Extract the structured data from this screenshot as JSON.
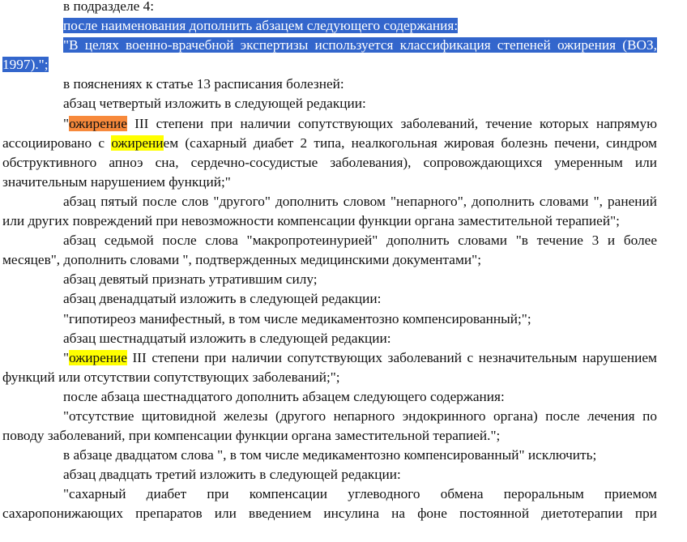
{
  "paragraphs": {
    "p1": "в подразделе 4:",
    "p2": "после наименования дополнить абзацем следующего содержания:",
    "p3": "\"В целях военно-врачебной экспертизы используется классификация степеней ожирения (ВОЗ, 1997).\";",
    "p4": "в пояснениях к статье 13 расписания болезней:",
    "p5": "абзац четвертый изложить в следующей редакции:",
    "p6a": "\"",
    "p6b": "ожирение",
    "p6c": " III степени при наличии сопутствующих заболеваний, течение которых напрямую ассоциировано с ",
    "p6d": "ожирени",
    "p6e": "ем (сахарный диабет 2 типа, неалкогольная жировая болезнь печени, синдром обструктивного апноэ сна, сердечно-сосудистые заболевания), сопровождающихся умеренным или значительным нарушением функций;\"",
    "p7": "абзац пятый после слов \"другого\" дополнить словом \"непарного\", дополнить словами \", ранений или других повреждений при невозможности компенсации функции органа заместительной терапией\";",
    "p8": "абзац седьмой после слова \"макропротеинурией\" дополнить словами \"в течение 3 и более месяцев\", дополнить словами \", подтвержденных медицинскими документами\";",
    "p9": "абзац девятый признать утратившим силу;",
    "p10": "абзац двенадцатый изложить в следующей редакции:",
    "p11": "\"гипотиреоз манифестный, в том числе медикаментозно компенсированный;\";",
    "p12": "абзац шестнадцатый изложить в следующей редакции:",
    "p13a": "\"",
    "p13b": "ожирение",
    "p13c": " III степени при наличии сопутствующих заболеваний с незначительным нарушением функций или отсутствии сопутствующих заболеваний;\";",
    "p14": "после абзаца шестнадцатого дополнить абзацем следующего содержания:",
    "p15": "\"отсутствие щитовидной железы (другого непарного эндокринного органа) после лечения по поводу заболеваний, при компенсации функции органа заместительной терапией.\";",
    "p16": "в абзаце двадцатом слова \", в том числе медикаментозно компенсированный\" исключить;",
    "p17": "абзац двадцать третий изложить в следующей редакции:",
    "p18": "\"сахарный диабет при компенсации углеводного обмена пероральным приемом сахаропонижающих препаратов или введением инсулина на фоне постоянной диетотерапии при"
  },
  "colors": {
    "selection": "#3366cc",
    "highlight_current": "#f7893b",
    "highlight_match": "#ffff00"
  }
}
